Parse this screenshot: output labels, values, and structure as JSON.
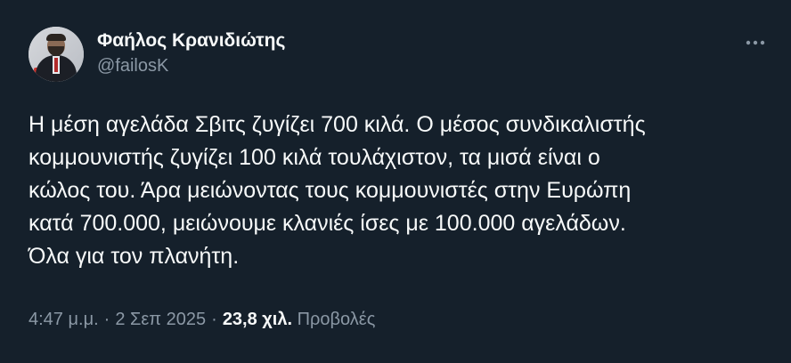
{
  "tweet": {
    "author": {
      "display_name": "Φαήλος Κρανιδιώτης",
      "handle": "@failosK",
      "avatar_icon": "profile-photo"
    },
    "text": "Η μέση αγελάδα Σβιτς ζυγίζει 700 κιλά. Ο μέσος συνδικαλιστής\nκομμουνιστής ζυγίζει 100 κιλά τουλάχιστον, τα μισά είναι ο\nκώλος του. Άρα μειώνοντας τους κομμουνιστές στην Ευρώπη\nκατά 700.000, μειώνουμε κλανιές ίσες με 100.000 αγελάδων.\nΌλα για τον πλανήτη.",
    "meta": {
      "time": "4:47 μ.μ.",
      "separator": "·",
      "date": "2 Σεπ 2025",
      "views_count": "23,8 χιλ.",
      "views_label": "Προβολές"
    },
    "more_icon": "more-horizontal-icon"
  },
  "colors": {
    "background": "#15202b",
    "primary_text": "#f7f9f9",
    "secondary_text": "#8b98a5"
  }
}
